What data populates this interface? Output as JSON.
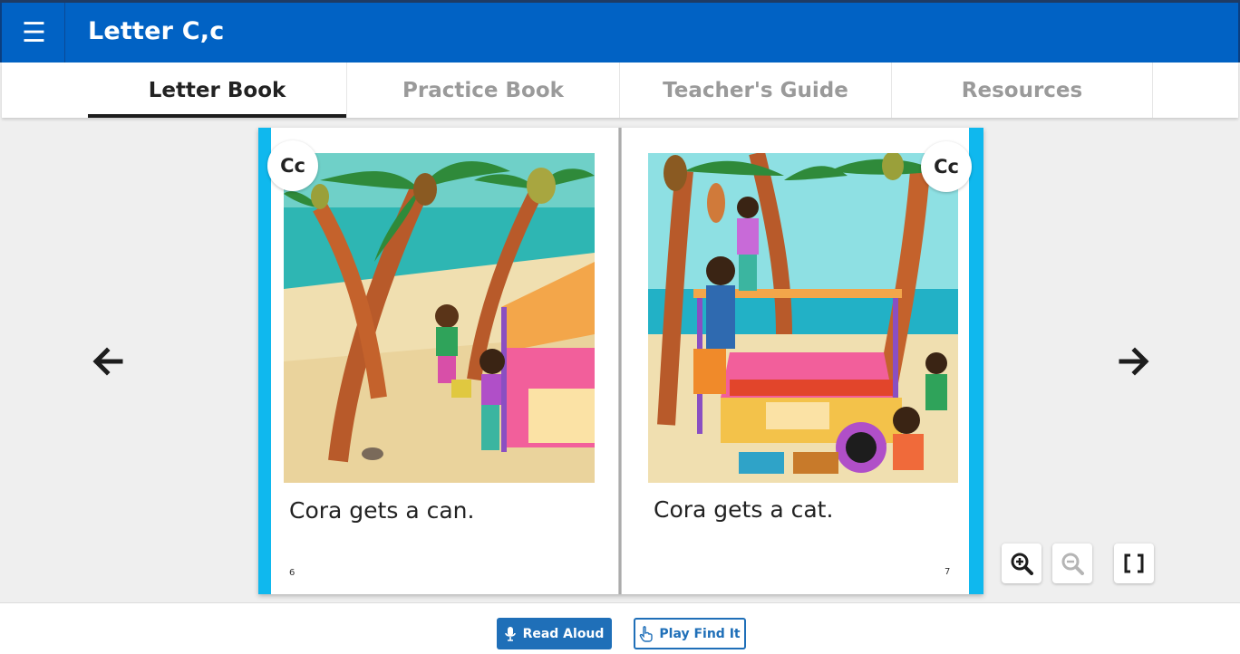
{
  "header": {
    "title": "Letter C,c",
    "menu_icon": "hamburger-menu-icon"
  },
  "tabs": [
    {
      "label": "Letter Book",
      "active": true
    },
    {
      "label": "Practice Book",
      "active": false
    },
    {
      "label": "Teacher's Guide",
      "active": false
    },
    {
      "label": "Resources",
      "active": false
    }
  ],
  "book": {
    "left_page": {
      "badge": "Cc",
      "text": "Cora gets a can.",
      "page_number": "6"
    },
    "right_page": {
      "badge": "Cc",
      "text": "Cora gets a cat.",
      "page_number": "7"
    }
  },
  "navigation": {
    "prev_icon": "arrow-left-icon",
    "next_icon": "arrow-right-icon"
  },
  "controls": {
    "zoom_in_icon": "zoom-in-icon",
    "zoom_out_icon": "zoom-out-icon",
    "fullscreen_icon": "fullscreen-icon"
  },
  "footer": {
    "read_aloud_label": "Read Aloud",
    "play_find_it_label": "Play Find It"
  },
  "colors": {
    "header_blue": "#0162c4",
    "page_edge": "#0fb8ee",
    "button_blue": "#1f6fb8"
  }
}
